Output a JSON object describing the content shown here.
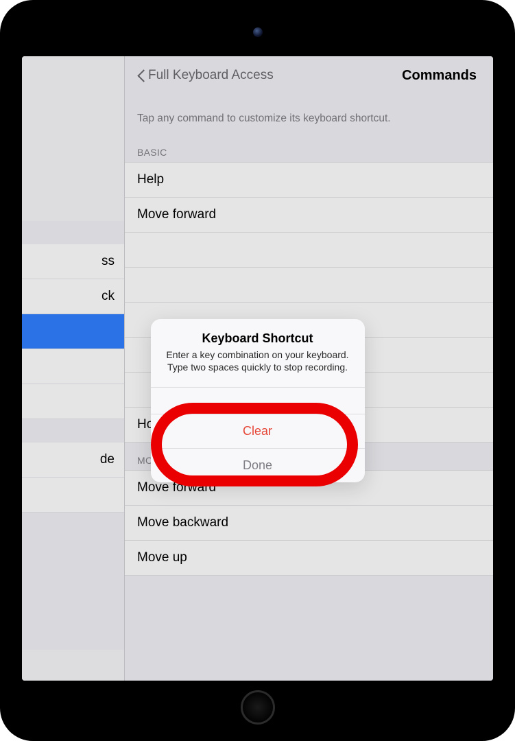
{
  "nav": {
    "back_label": "Full Keyboard Access",
    "title": "Commands"
  },
  "hint": "Tap any command to customize its keyboard shortcut.",
  "sections": {
    "basic": {
      "header": "BASIC",
      "rows": [
        "Help",
        "Move forward",
        "",
        "",
        "",
        "",
        "",
        "Home"
      ]
    },
    "movement": {
      "header": "MOVEMENT",
      "rows": [
        "Move forward",
        "Move backward",
        "Move up"
      ]
    }
  },
  "sidebar": {
    "items": [
      {
        "label": "ss",
        "selected": false
      },
      {
        "label": "ck",
        "selected": false
      },
      {
        "label": "",
        "selected": true
      },
      {
        "label": "",
        "selected": false
      },
      {
        "label": "",
        "selected": false
      },
      {
        "label": "de",
        "selected": false
      },
      {
        "label": "",
        "selected": false
      }
    ]
  },
  "modal": {
    "title": "Keyboard Shortcut",
    "subtitle": "Enter a key combination on your keyboard. Type two spaces quickly to stop recording.",
    "clear_label": "Clear",
    "done_label": "Done"
  }
}
